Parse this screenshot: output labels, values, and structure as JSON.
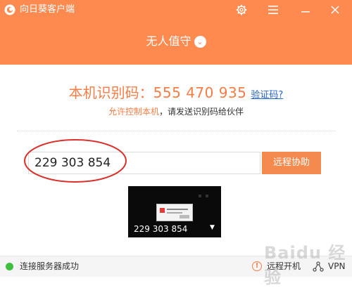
{
  "window": {
    "title": "向日葵客户端",
    "controls": {
      "settings_icon": "gear-icon",
      "menu_icon": "hamburger-icon",
      "minimize_icon": "minimize-icon",
      "close_icon": "close-icon"
    }
  },
  "header": {
    "mode_label": "无人值守",
    "mode_chevron": "⌄"
  },
  "identity": {
    "label": "本机识别码：",
    "code": "555 470 935",
    "verify_link": "验证码?",
    "permission_link": "允许控制本机",
    "permission_rest": "，请发送识别码给伙伴"
  },
  "remote": {
    "partner_code": "229 303 854",
    "assist_button": "远程协助"
  },
  "preview": {
    "label": "229 303 854",
    "expand_arrow": "▼"
  },
  "status": {
    "connection_text": "连接服务器成功",
    "connection_color": "#3fbf3f",
    "warning_icon": "!",
    "remote_boot": "远程开机",
    "vpn": "VPN"
  },
  "watermark": "Baidu 经验",
  "colors": {
    "accent": "#ff8a50",
    "button": "#f58a4f",
    "link": "#2563c9",
    "annotation": "#d9302b"
  }
}
